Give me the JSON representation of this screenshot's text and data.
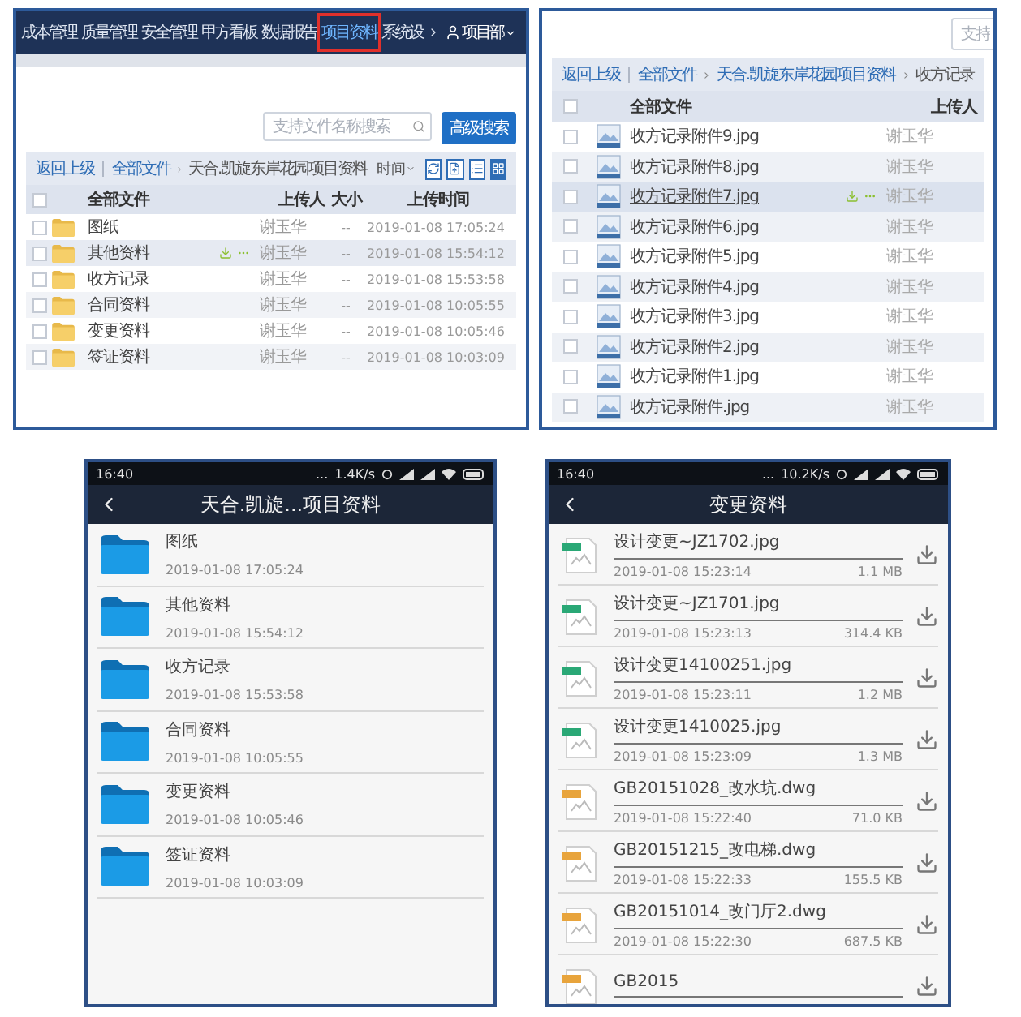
{
  "web_list": {
    "nav": [
      {
        "label": "成本管理",
        "selected": false
      },
      {
        "label": "质量管理",
        "selected": false
      },
      {
        "label": "安全管理",
        "selected": false
      },
      {
        "label": "甲方看板",
        "selected": false
      },
      {
        "label": "数据报告",
        "selected": false
      },
      {
        "label": "项目资料",
        "selected": true
      },
      {
        "label": "系统设",
        "selected": false
      }
    ],
    "user": "项目部",
    "search": {
      "placeholder": "支持文件名称搜索"
    },
    "advanced_button": "高级搜索",
    "back": "返回上级",
    "breadcrumb": [
      "全部文件",
      "天合.凯旋东岸花园项目资料"
    ],
    "sort": "时间",
    "select_all_checked": false,
    "columns": [
      "全部文件",
      "上传人",
      "大小",
      "上传时间"
    ],
    "rows": [
      {
        "name": "图纸",
        "uploader": "谢玉华",
        "size": "--",
        "time": "2019-01-08 17:05:24",
        "hovered": false
      },
      {
        "name": "其他资料",
        "uploader": "谢玉华",
        "size": "--",
        "time": "2019-01-08 15:54:12",
        "hovered": true
      },
      {
        "name": "收方记录",
        "uploader": "谢玉华",
        "size": "--",
        "time": "2019-01-08 15:53:58",
        "hovered": false
      },
      {
        "name": "合同资料",
        "uploader": "谢玉华",
        "size": "--",
        "time": "2019-01-08 10:05:55",
        "hovered": false
      },
      {
        "name": "变更资料",
        "uploader": "谢玉华",
        "size": "--",
        "time": "2019-01-08 10:05:46",
        "hovered": false
      },
      {
        "name": "签证资料",
        "uploader": "谢玉华",
        "size": "--",
        "time": "2019-01-08 10:03:09",
        "hovered": false
      }
    ]
  },
  "web_detail": {
    "search": {
      "placeholder": "支持"
    },
    "back": "返回上级",
    "breadcrumb": [
      "全部文件",
      "天合.凯旋东岸花园项目资料",
      "收方记录"
    ],
    "select_all_checked": false,
    "columns": [
      "全部文件",
      "上传人"
    ],
    "rows": [
      {
        "name": "收方记录附件9.jpg",
        "uploader": "谢玉华",
        "hovered": false
      },
      {
        "name": "收方记录附件8.jpg",
        "uploader": "谢玉华",
        "hovered": false
      },
      {
        "name": "收方记录附件7.jpg",
        "uploader": "谢玉华",
        "hovered": true
      },
      {
        "name": "收方记录附件6.jpg",
        "uploader": "谢玉华",
        "hovered": false
      },
      {
        "name": "收方记录附件5.jpg",
        "uploader": "谢玉华",
        "hovered": false
      },
      {
        "name": "收方记录附件4.jpg",
        "uploader": "谢玉华",
        "hovered": false
      },
      {
        "name": "收方记录附件3.jpg",
        "uploader": "谢玉华",
        "hovered": false
      },
      {
        "name": "收方记录附件2.jpg",
        "uploader": "谢玉华",
        "hovered": false
      },
      {
        "name": "收方记录附件1.jpg",
        "uploader": "谢玉华",
        "hovered": false
      },
      {
        "name": "收方记录附件.jpg",
        "uploader": "谢玉华",
        "hovered": false
      }
    ]
  },
  "mobile_folders": {
    "status": {
      "time": "16:40",
      "dots": "...",
      "speed": "1.4K/s"
    },
    "title": "天合.凯旋...项目资料",
    "items": [
      {
        "name": "图纸",
        "date": "2019-01-08 17:05:24"
      },
      {
        "name": "其他资料",
        "date": "2019-01-08 15:54:12"
      },
      {
        "name": "收方记录",
        "date": "2019-01-08 15:53:58"
      },
      {
        "name": "合同资料",
        "date": "2019-01-08 10:05:55"
      },
      {
        "name": "变更资料",
        "date": "2019-01-08 10:05:46"
      },
      {
        "name": "签证资料",
        "date": "2019-01-08 10:03:09"
      }
    ]
  },
  "mobile_files": {
    "status": {
      "time": "16:40",
      "dots": "...",
      "speed": "10.2K/s"
    },
    "title": "变更资料",
    "items": [
      {
        "kind": "jpg",
        "name": "设计变更~JZ1702.jpg",
        "date": "2019-01-08 15:23:14",
        "size": "1.1 MB"
      },
      {
        "kind": "jpg",
        "name": "设计变更~JZ1701.jpg",
        "date": "2019-01-08 15:23:13",
        "size": "314.4 KB"
      },
      {
        "kind": "jpg",
        "name": "设计变更14100251.jpg",
        "date": "2019-01-08 15:23:11",
        "size": "1.2 MB"
      },
      {
        "kind": "jpg",
        "name": "设计变更1410025.jpg",
        "date": "2019-01-08 15:23:09",
        "size": "1.3 MB"
      },
      {
        "kind": "dwg",
        "name": "GB20151028_改水坑.dwg",
        "date": "2019-01-08 15:22:40",
        "size": "71.0 KB"
      },
      {
        "kind": "dwg",
        "name": "GB20151215_改电梯.dwg",
        "date": "2019-01-08 15:22:33",
        "size": "155.5 KB"
      },
      {
        "kind": "dwg",
        "name": "GB20151014_改门厅2.dwg",
        "date": "2019-01-08 15:22:30",
        "size": "687.5 KB"
      },
      {
        "kind": "dwg",
        "name": "GB2015"
      }
    ]
  }
}
